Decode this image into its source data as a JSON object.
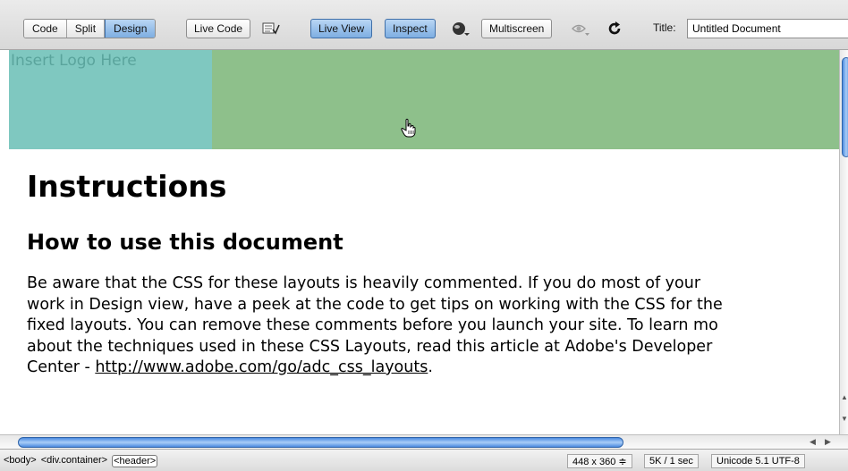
{
  "toolbar": {
    "view_modes": [
      {
        "label": "Code",
        "active": false
      },
      {
        "label": "Split",
        "active": false
      },
      {
        "label": "Design",
        "active": true
      }
    ],
    "live_code_label": "Live Code",
    "live_view_label": "Live View",
    "inspect_label": "Inspect",
    "multiscreen_label": "Multiscreen",
    "title_label": "Title:",
    "title_value": "Untitled Document",
    "icons": [
      "validate-icon",
      "globe-browser-icon",
      "visual-aids-icon",
      "refresh-icon"
    ],
    "active_color": "#7eaee2"
  },
  "canvas": {
    "logo_placeholder": "Insert Logo Here",
    "logo_bg_color": "#7fc8c0",
    "header_bg_color": "#8ec08b",
    "heading": "Instructions",
    "subheading": "How to use this document",
    "paragraph_lines": [
      "Be aware that the CSS for these layouts is heavily commented. If you do most of your",
      "work in Design view, have a peek at the code to get tips on working with the CSS for the",
      "fixed layouts. You can remove these comments before you launch your site. To learn mo",
      "about the techniques used in these CSS Layouts, read this article at Adobe's Developer"
    ],
    "last_line_prefix": "Center - ",
    "link_text": "http://www.adobe.com/go/adc_css_layouts",
    "last_line_suffix": "."
  },
  "statusbar": {
    "tag_body": "<body>",
    "tag_container": "<div.container>",
    "tag_header": "<header>",
    "window_size": "448 x 360 ≑",
    "download_stats": "5K / 1 sec",
    "encoding": "Unicode 5.1 UTF-8"
  }
}
